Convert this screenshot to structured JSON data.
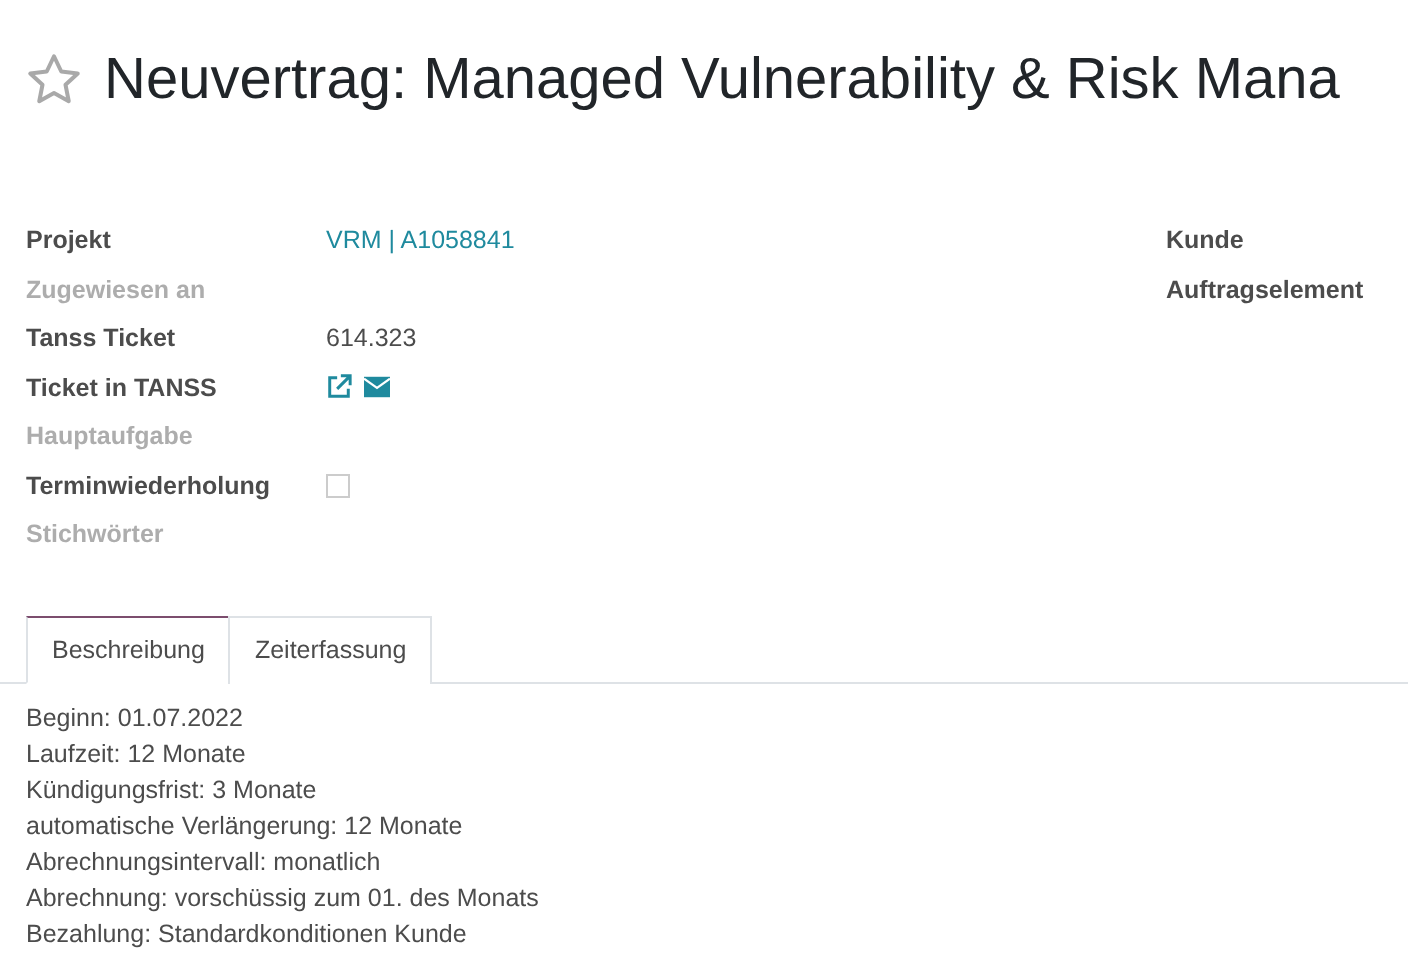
{
  "title": {
    "text": "Neuvertrag: Managed Vulnerability & Risk Mana",
    "starred": false
  },
  "fields_left": [
    {
      "label": "Projekt",
      "muted": false,
      "kind": "link",
      "value": "VRM | A1058841"
    },
    {
      "label": "Zugewiesen an",
      "muted": true
    },
    {
      "label": "Tanss Ticket",
      "muted": false,
      "kind": "text",
      "value": "614.323"
    },
    {
      "label": "Ticket in TANSS",
      "muted": false,
      "kind": "icons"
    },
    {
      "label": "Hauptaufgabe",
      "muted": true
    },
    {
      "label": "Terminwiederholung",
      "muted": false,
      "kind": "checkbox",
      "checked": false
    },
    {
      "label": "Stichwörter",
      "muted": true
    }
  ],
  "fields_right": [
    {
      "label": "Kunde",
      "muted": false
    },
    {
      "label": "Auftragselement",
      "muted": false
    }
  ],
  "tabs": [
    {
      "label": "Beschreibung",
      "selected": true
    },
    {
      "label": "Zeiterfassung",
      "selected": false
    }
  ],
  "description": [
    "Beginn: 01.07.2022",
    "Laufzeit: 12 Monate",
    "Kündigungsfrist: 3 Monate",
    "automatische Verlängerung: 12 Monate",
    "Abrechnungsintervall: monatlich",
    "Abrechnung: vorschüssig zum 01. des Monats",
    "Bezahlung: Standardkonditionen Kunde"
  ]
}
